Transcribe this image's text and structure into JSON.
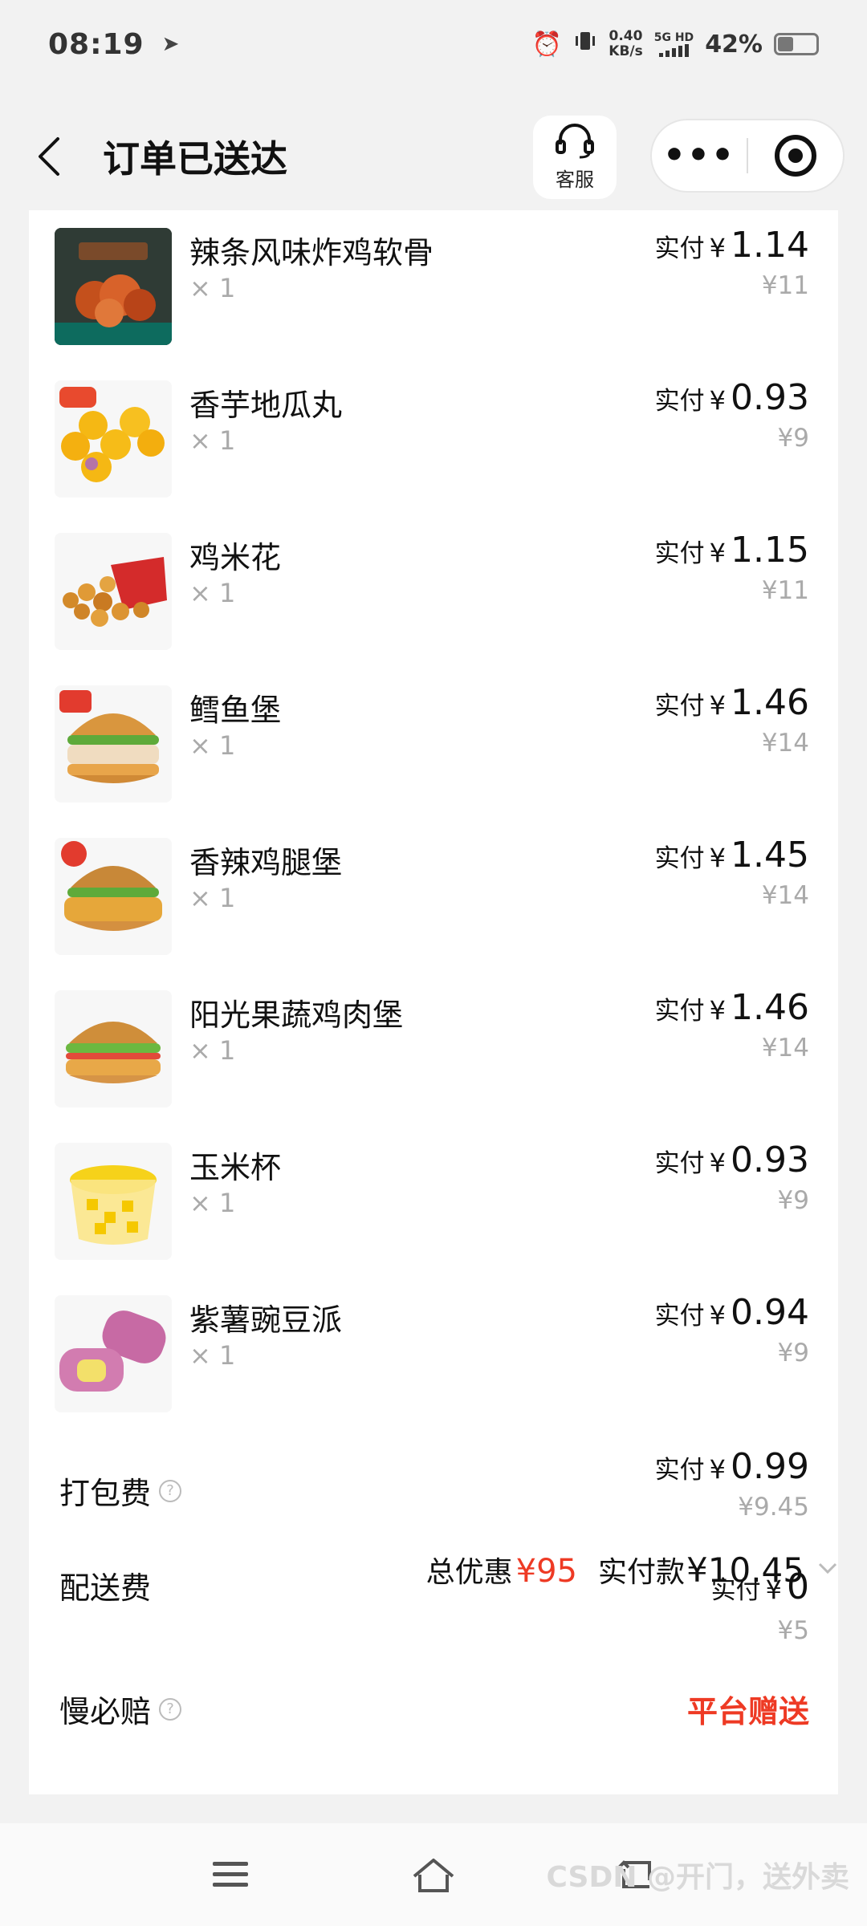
{
  "status_bar": {
    "time": "08:19",
    "net_speed_value": "0.40",
    "net_speed_unit": "KB/s",
    "signal_label": "5G HD",
    "battery_percent": "42%",
    "battery_level": 0.42
  },
  "header": {
    "title": "订单已送达",
    "service_label": "客服"
  },
  "items": [
    {
      "name": "辣条风味炸鸡软骨",
      "qty": "× 1",
      "pay_label": "实付",
      "currency": "¥",
      "paid": "1.14",
      "original": "¥11"
    },
    {
      "name": "香芋地瓜丸",
      "qty": "× 1",
      "pay_label": "实付",
      "currency": "¥",
      "paid": "0.93",
      "original": "¥9"
    },
    {
      "name": "鸡米花",
      "qty": "× 1",
      "pay_label": "实付",
      "currency": "¥",
      "paid": "1.15",
      "original": "¥11"
    },
    {
      "name": "鳕鱼堡",
      "qty": "× 1",
      "pay_label": "实付",
      "currency": "¥",
      "paid": "1.46",
      "original": "¥14"
    },
    {
      "name": "香辣鸡腿堡",
      "qty": "× 1",
      "pay_label": "实付",
      "currency": "¥",
      "paid": "1.45",
      "original": "¥14"
    },
    {
      "name": "阳光果蔬鸡肉堡",
      "qty": "× 1",
      "pay_label": "实付",
      "currency": "¥",
      "paid": "1.46",
      "original": "¥14"
    },
    {
      "name": "玉米杯",
      "qty": "× 1",
      "pay_label": "实付",
      "currency": "¥",
      "paid": "0.93",
      "original": "¥9"
    },
    {
      "name": "紫薯豌豆派",
      "qty": "× 1",
      "pay_label": "实付",
      "currency": "¥",
      "paid": "0.94",
      "original": "¥9"
    }
  ],
  "fees": {
    "packing": {
      "label": "打包费",
      "pay_label": "实付",
      "currency": "¥",
      "paid": "0.99",
      "original": "¥9.45"
    },
    "delivery": {
      "label": "配送费",
      "pay_label": "实付",
      "currency": "¥",
      "paid": "0",
      "original": "¥5"
    },
    "late_guarantee": {
      "label": "慢必赔",
      "value": "平台赠送"
    }
  },
  "summary": {
    "discount_label": "总优惠",
    "discount_value": "¥95",
    "pay_label": "实付款",
    "pay_value": "¥10.45"
  },
  "watermark": "CSDN @开门，送外卖",
  "colors": {
    "accent_red": "#ee3a24",
    "muted_text": "#aaaaaa",
    "background": "#f2f2f2"
  }
}
